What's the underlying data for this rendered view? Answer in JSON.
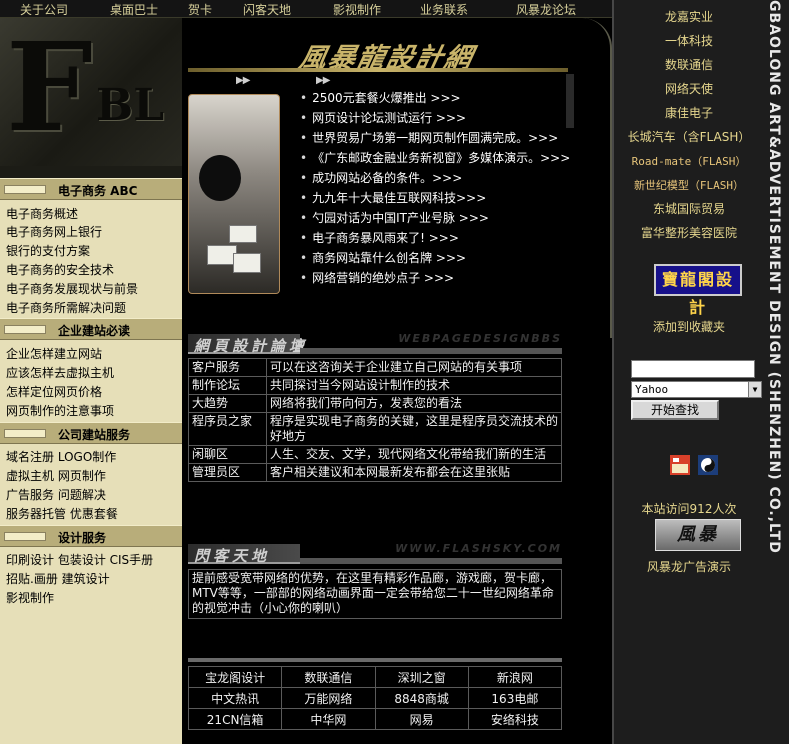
{
  "topnav": [
    "关于公司",
    "桌面巴士",
    "贺卡",
    "闪客天地",
    "影视制作",
    "业务联系",
    "风暴龙论坛"
  ],
  "logo_text": {
    "big": "F",
    "small": "BL"
  },
  "left": {
    "sections": [
      {
        "title": "电子商务 ABC",
        "items": [
          "电子商务概述",
          "电子商务网上银行",
          "银行的支付方案",
          "电子商务的安全技术",
          "电子商务发展现状与前景",
          "电子商务所需解决问题"
        ]
      },
      {
        "title": "企业建站必读",
        "items": [
          "企业怎样建立网站",
          "应该怎样去虚拟主机",
          "怎样定位网页价格",
          "网页制作的注意事项"
        ]
      },
      {
        "title": "公司建站服务",
        "items": [
          "域名注册  LOGO制作",
          "虚拟主机  网页制作",
          "广告服务  问题解决",
          "服务器托管  优惠套餐"
        ]
      },
      {
        "title": "设计服务",
        "items": [
          "印刷设计  包装设计  CIS手册",
          "招贴.画册  建筑设计",
          "影视制作"
        ]
      }
    ]
  },
  "center": {
    "brand": "風暴龍設計網",
    "arrows": [
      "▶▶",
      "▶▶"
    ],
    "news": [
      "2500元套餐火爆推出 >>>",
      "网页设计论坛测试运行 >>>",
      "世界贸易广场第一期网页制作圆满完成。>>>",
      "《广东邮政金融业务新视窗》多媒体演示。>>>",
      "成功网站必备的条件。>>>",
      "九九年十大最佳互联网科技>>>",
      "勺园对话为中国IT产业号脉 >>>",
      "电子商务暴风雨来了! >>>",
      "商务网站靠什么创名牌 >>>",
      "网络营销的绝妙点子 >>>"
    ],
    "forum_header": {
      "title": "網頁設計論壇",
      "en": "WEBPAGEDESIGNBBS"
    },
    "forum": [
      {
        "name": "客户服务",
        "desc": "可以在这咨询关于企业建立自己网站的有关事项"
      },
      {
        "name": "制作论坛",
        "desc": "共同探讨当今网站设计制作的技术"
      },
      {
        "name": "大趋势",
        "desc": "网络将我们带向何方，发表您的看法"
      },
      {
        "name": "程序员之家",
        "desc": "程序是实现电子商务的关键，这里是程序员交流技术的好地方"
      },
      {
        "name": "闲聊区",
        "desc": "人生、交友、文学，现代网络文化带给我们新的生活"
      },
      {
        "name": "管理员区",
        "desc": "客户相关建议和本网最新发布都会在这里张贴"
      }
    ],
    "flash_header": {
      "title": "閃客天地",
      "en": "WWW.FLASHSKY.COM"
    },
    "flash_text": "提前感受宽带网络的优势，在这里有精彩作品廊，游戏廊，贺卡廊，MTV等等，一部部的网络动画界面一定会带给您二十一世纪网络革命的视觉冲击（小心你的喇叭）",
    "links": [
      [
        "宝龙阁设计",
        "数联通信",
        "深圳之窗",
        "新浪网"
      ],
      [
        "中文热讯",
        "万能网络",
        "8848商城",
        "163电邮"
      ],
      [
        "21CN信箱",
        "中华网",
        "网易",
        "安络科技"
      ]
    ]
  },
  "right": {
    "links": [
      "龙嘉实业",
      "一体科技",
      "数联通信",
      "网络天使",
      "康佳电子",
      "长城汽车（含FLASH）",
      "Road-mate（FLASH）",
      "新世纪模型（FLASH）",
      "东城国际贸易",
      "富华整形美容医院"
    ],
    "vertical": "GBAOLONG ART&ADVERTISEMENT DESIGN (SHENZHEN) CO.,LTD",
    "badge": "寶龍閣設計",
    "bookmark": "添加到收藏夹",
    "search": {
      "value": "",
      "engine": "Yahoo",
      "button": "开始查找"
    },
    "visits": "本站访问912人次",
    "fb_logo": "風暴",
    "ad_demo": "风暴龙广告演示"
  },
  "colors": {
    "accent_gold": "#c9b46a",
    "left_bg": "#e6dfb8",
    "right_link": "#e6d78e"
  }
}
